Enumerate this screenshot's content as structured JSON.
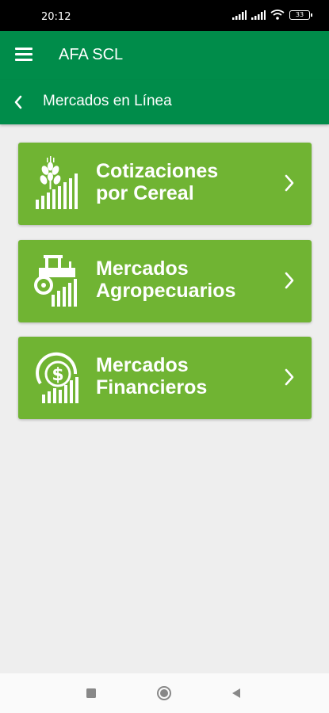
{
  "status_bar": {
    "time": "20:12",
    "battery": "33"
  },
  "app_bar": {
    "title": "AFA SCL"
  },
  "sub_bar": {
    "title": "Mercados en Línea"
  },
  "cards": [
    {
      "line1": "Cotizaciones",
      "line2": "por Cereal",
      "icon": "wheat-chart-icon"
    },
    {
      "line1": "Mercados",
      "line2": "Agropecuarios",
      "icon": "tractor-chart-icon"
    },
    {
      "line1": "Mercados",
      "line2": "Financieros",
      "icon": "dollar-chart-icon"
    }
  ],
  "colors": {
    "primary": "#008c4a",
    "card": "#70b433",
    "background": "#eeeeee"
  }
}
